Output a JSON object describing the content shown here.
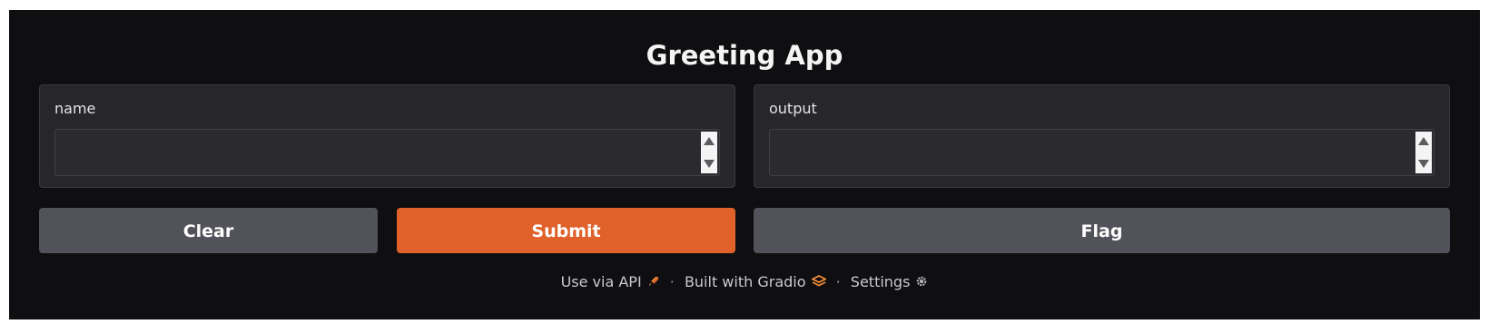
{
  "app": {
    "title": "Greeting App"
  },
  "inputs": {
    "name": {
      "label": "name",
      "value": ""
    },
    "output": {
      "label": "output",
      "value": ""
    }
  },
  "buttons": {
    "clear": "Clear",
    "submit": "Submit",
    "flag": "Flag"
  },
  "footer": {
    "api_label": "Use via API",
    "api_icon": "rocket-icon",
    "built_label": "Built with Gradio",
    "built_icon": "gradio-logo-icon",
    "settings_label": "Settings",
    "settings_icon": "gear-icon",
    "separator": "·"
  },
  "colors": {
    "background": "#0f0f11",
    "panel": "#27272a",
    "primary_button": "#e0612a",
    "secondary_button": "#52525b",
    "accent_icon": "#f28c38"
  }
}
